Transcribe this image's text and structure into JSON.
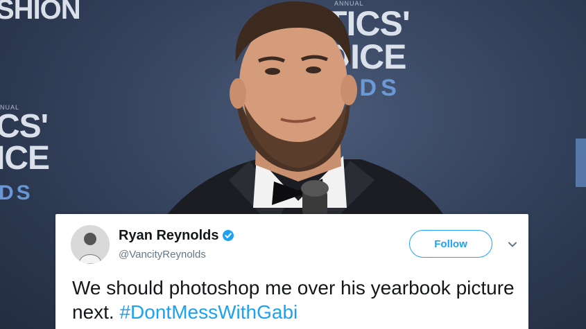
{
  "backdrop": {
    "top_left": "SHION",
    "center_line1": "TICS'",
    "center_line2": "DICE",
    "center_line3": "RDS",
    "left_line1": "CS'",
    "left_line2": "ICE",
    "left_line3": "DS",
    "small_top": "ANNUAL",
    "small_left": "NUAL"
  },
  "tweet": {
    "display_name": "Ryan Reynolds",
    "handle": "@VancityReynolds",
    "follow_label": "Follow",
    "text_main": "We should photoshop me over his yearbook picture next.",
    "hashtag": "#DontMessWithGabi",
    "verified_icon": "verified-badge-icon",
    "menu_icon": "chevron-down-icon"
  },
  "colors": {
    "twitter_blue": "#1da1f2",
    "backdrop_blue": "#3a4863",
    "text_dark": "#14171a",
    "handle_gray": "#657786"
  }
}
